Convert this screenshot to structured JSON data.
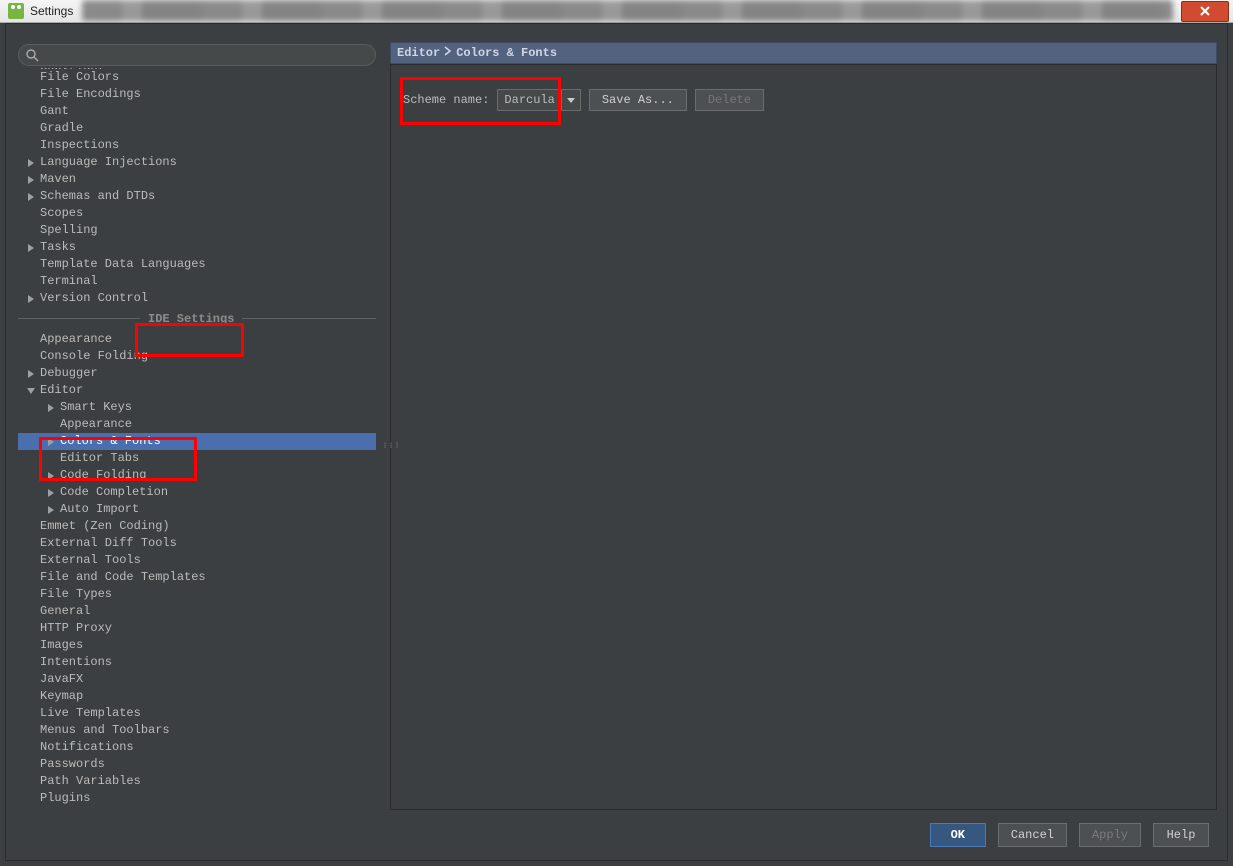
{
  "window": {
    "title": "Settings"
  },
  "search": {
    "placeholder": ""
  },
  "tree": {
    "top": [
      {
        "label": "Copyright",
        "indent": 22,
        "arrow": null,
        "cut": true
      },
      {
        "label": "File Colors",
        "indent": 22,
        "arrow": null
      },
      {
        "label": "File Encodings",
        "indent": 22,
        "arrow": null
      },
      {
        "label": "Gant",
        "indent": 22,
        "arrow": null
      },
      {
        "label": "Gradle",
        "indent": 22,
        "arrow": null
      },
      {
        "label": "Inspections",
        "indent": 22,
        "arrow": null
      },
      {
        "label": "Language Injections",
        "indent": 22,
        "arrow": "right"
      },
      {
        "label": "Maven",
        "indent": 22,
        "arrow": "right"
      },
      {
        "label": "Schemas and DTDs",
        "indent": 22,
        "arrow": "right"
      },
      {
        "label": "Scopes",
        "indent": 22,
        "arrow": null
      },
      {
        "label": "Spelling",
        "indent": 22,
        "arrow": null
      },
      {
        "label": "Tasks",
        "indent": 22,
        "arrow": "right"
      },
      {
        "label": "Template Data Languages",
        "indent": 22,
        "arrow": null
      },
      {
        "label": "Terminal",
        "indent": 22,
        "arrow": null
      },
      {
        "label": "Version Control",
        "indent": 22,
        "arrow": "right"
      }
    ],
    "section": "IDE Settings",
    "bottom": [
      {
        "label": "Appearance",
        "indent": 22,
        "arrow": null
      },
      {
        "label": "Console Folding",
        "indent": 22,
        "arrow": null
      },
      {
        "label": "Debugger",
        "indent": 22,
        "arrow": "right"
      },
      {
        "label": "Editor",
        "indent": 22,
        "arrow": "down"
      },
      {
        "label": "Smart Keys",
        "indent": 42,
        "arrow": "right"
      },
      {
        "label": "Appearance",
        "indent": 42,
        "arrow": null
      },
      {
        "label": "Colors & Fonts",
        "indent": 42,
        "arrow": "right",
        "selected": true
      },
      {
        "label": "Editor Tabs",
        "indent": 42,
        "arrow": null
      },
      {
        "label": "Code Folding",
        "indent": 42,
        "arrow": "right"
      },
      {
        "label": "Code Completion",
        "indent": 42,
        "arrow": "right"
      },
      {
        "label": "Auto Import",
        "indent": 42,
        "arrow": "right"
      },
      {
        "label": "Emmet (Zen Coding)",
        "indent": 22,
        "arrow": null
      },
      {
        "label": "External Diff Tools",
        "indent": 22,
        "arrow": null
      },
      {
        "label": "External Tools",
        "indent": 22,
        "arrow": null
      },
      {
        "label": "File and Code Templates",
        "indent": 22,
        "arrow": null
      },
      {
        "label": "File Types",
        "indent": 22,
        "arrow": null
      },
      {
        "label": "General",
        "indent": 22,
        "arrow": null
      },
      {
        "label": "HTTP Proxy",
        "indent": 22,
        "arrow": null
      },
      {
        "label": "Images",
        "indent": 22,
        "arrow": null
      },
      {
        "label": "Intentions",
        "indent": 22,
        "arrow": null
      },
      {
        "label": "JavaFX",
        "indent": 22,
        "arrow": null
      },
      {
        "label": "Keymap",
        "indent": 22,
        "arrow": null
      },
      {
        "label": "Live Templates",
        "indent": 22,
        "arrow": null
      },
      {
        "label": "Menus and Toolbars",
        "indent": 22,
        "arrow": null
      },
      {
        "label": "Notifications",
        "indent": 22,
        "arrow": null
      },
      {
        "label": "Passwords",
        "indent": 22,
        "arrow": null
      },
      {
        "label": "Path Variables",
        "indent": 22,
        "arrow": null
      },
      {
        "label": "Plugins",
        "indent": 22,
        "arrow": null
      }
    ]
  },
  "breadcrumb": {
    "a": "Editor",
    "b": "Colors & Fonts"
  },
  "scheme": {
    "label": "Scheme name:",
    "value": "Darcula",
    "save_as": "Save As...",
    "del": "Delete"
  },
  "footer": {
    "ok": "OK",
    "cancel": "Cancel",
    "apply": "Apply",
    "help": "Help"
  }
}
